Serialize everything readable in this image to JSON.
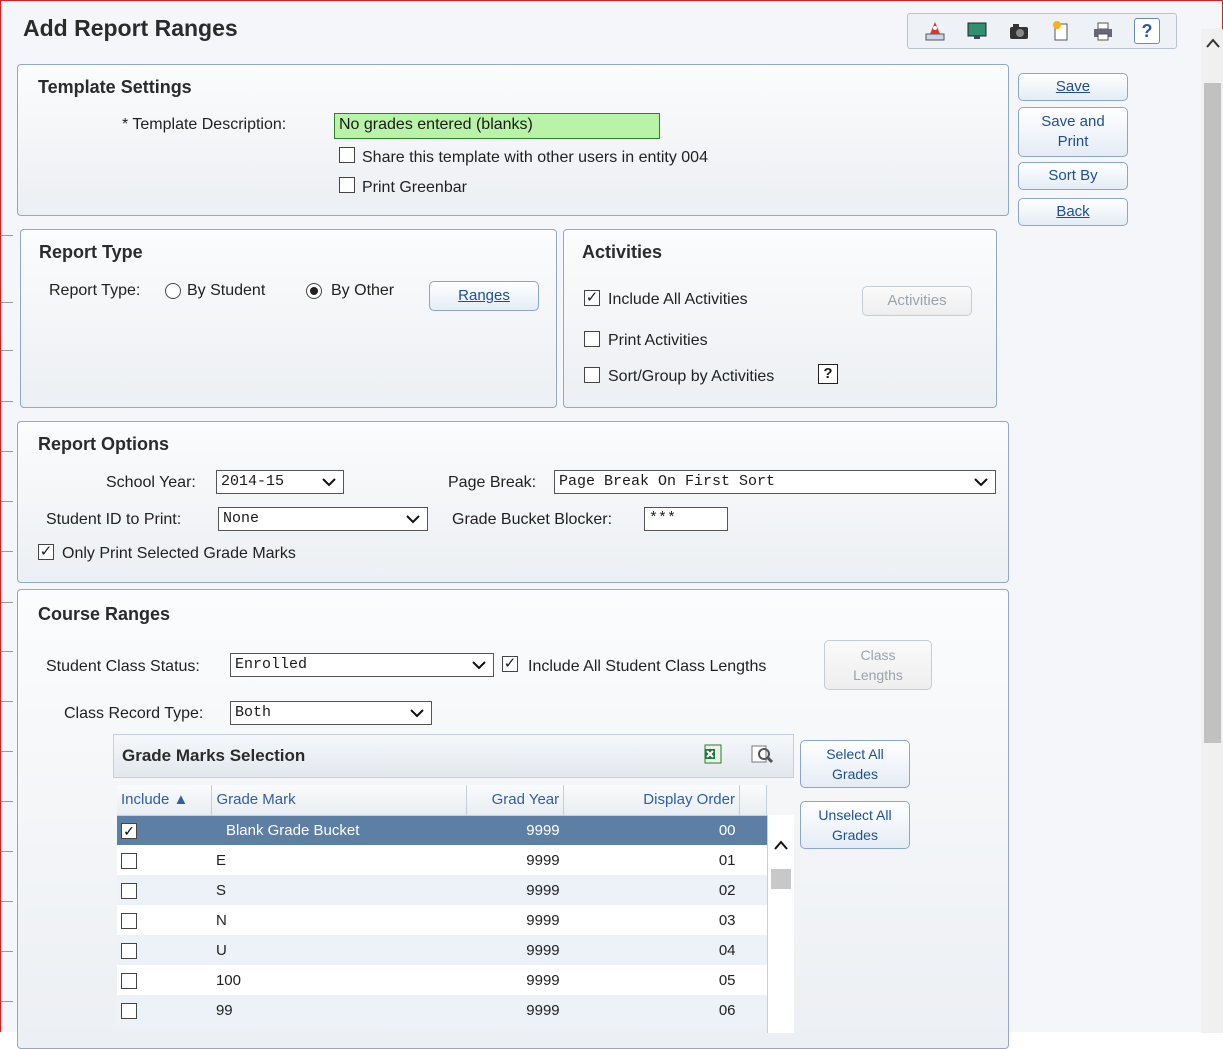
{
  "page": {
    "title": "Add Report Ranges"
  },
  "toolbar": {
    "icons": [
      "report-map-icon",
      "monitor-icon",
      "camera-icon",
      "new-page-icon",
      "printer-icon",
      "help-icon"
    ],
    "help_label": "?"
  },
  "actions": {
    "save": "Save",
    "save_and_print_1": "Save and",
    "save_and_print_2": "Print",
    "sort_by": "Sort By",
    "back": "Back"
  },
  "template_settings": {
    "title": "Template Settings",
    "description_label": "* Template Description:",
    "description_value": "No grades entered (blanks)",
    "share_label": "Share this template with other users in entity 004",
    "share_checked": false,
    "greenbar_label": "Print Greenbar",
    "greenbar_checked": false
  },
  "report_type": {
    "title": "Report Type",
    "label": "Report Type:",
    "option_student": "By Student",
    "option_other": "By Other",
    "selected": "By Other",
    "ranges_button": "Ranges"
  },
  "activities": {
    "title": "Activities",
    "include_all_label": "Include All Activities",
    "include_all_checked": true,
    "activities_button": "Activities",
    "print_label": "Print Activities",
    "sort_group_label": "Sort/Group by Activities",
    "help_label": "?"
  },
  "report_options": {
    "title": "Report Options",
    "school_year_label": "School Year:",
    "school_year_value": "2014-15",
    "page_break_label": "Page Break:",
    "page_break_value": "Page Break On First Sort",
    "student_id_label": "Student ID to Print:",
    "student_id_value": "None",
    "bucket_blocker_label": "Grade Bucket Blocker:",
    "bucket_blocker_value": "***",
    "only_selected_label": "Only Print Selected Grade Marks",
    "only_selected_checked": true
  },
  "course_ranges": {
    "title": "Course Ranges",
    "class_status_label": "Student Class Status:",
    "class_status_value": "Enrolled",
    "include_lengths_label": "Include All Student Class Lengths",
    "include_lengths_checked": true,
    "class_lengths_button_1": "Class",
    "class_lengths_button_2": "Lengths",
    "record_type_label": "Class Record Type:",
    "record_type_value": "Both",
    "select_all_1": "Select All",
    "select_all_2": "Grades",
    "unselect_all_1": "Unselect All",
    "unselect_all_2": "Grades"
  },
  "grade_marks": {
    "title": "Grade Marks Selection",
    "columns": [
      "Include ▲",
      "Grade Mark",
      "Grad Year",
      "Display Order"
    ],
    "rows": [
      {
        "checked": true,
        "mark": "Blank Grade Bucket",
        "year": "9999",
        "order": "00"
      },
      {
        "checked": false,
        "mark": "E",
        "year": "9999",
        "order": "01"
      },
      {
        "checked": false,
        "mark": "S",
        "year": "9999",
        "order": "02"
      },
      {
        "checked": false,
        "mark": "N",
        "year": "9999",
        "order": "03"
      },
      {
        "checked": false,
        "mark": "U",
        "year": "9999",
        "order": "04"
      },
      {
        "checked": false,
        "mark": "100",
        "year": "9999",
        "order": "05"
      },
      {
        "checked": false,
        "mark": "99",
        "year": "9999",
        "order": "06"
      }
    ]
  }
}
